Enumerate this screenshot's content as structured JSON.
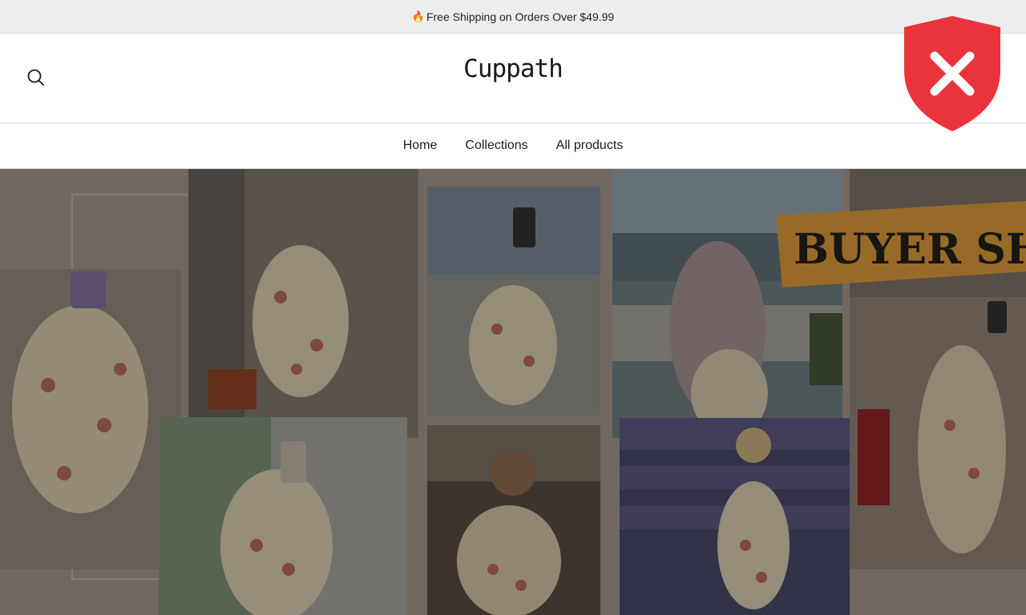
{
  "announcement": {
    "icon": "fire-icon",
    "text": "Free Shipping on Orders Over $49.99"
  },
  "header": {
    "logo": "Cuppath",
    "search_icon": "search-icon"
  },
  "nav": {
    "items": [
      "Home",
      "Collections",
      "All products"
    ]
  },
  "hero": {
    "banner_text": "BUYER SHO"
  },
  "badge": {
    "icon": "shield-x-icon",
    "color": "#e8343a"
  }
}
